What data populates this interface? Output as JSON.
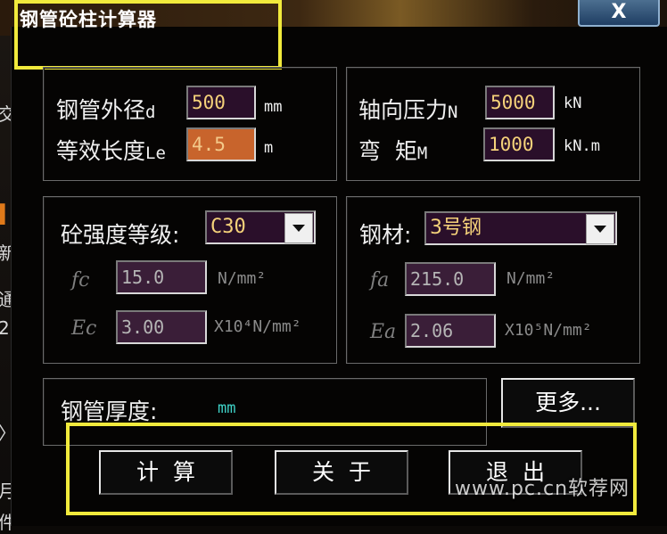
{
  "window": {
    "title": "钢管砼柱计算器",
    "close_label": "X"
  },
  "geometry": {
    "diameter": {
      "label": "钢管外径",
      "sub": "d",
      "value": "500",
      "unit": "mm"
    },
    "length": {
      "label": "等效长度",
      "sub": "Le",
      "value": "4.5",
      "unit": "m"
    }
  },
  "loads": {
    "axial": {
      "label": "轴向压力",
      "sub": "N",
      "value": "5000",
      "unit": "kN"
    },
    "moment": {
      "label": "弯  矩",
      "sub": "M",
      "value": "1000",
      "unit": "kN.m"
    }
  },
  "concrete": {
    "grade_label": "砼强度等级:",
    "grade_value": "C30",
    "fc": {
      "label": "fc",
      "value": "15.0",
      "unit": "N/mm²"
    },
    "ec": {
      "label": "Ec",
      "value": "3.00",
      "unit": "X10⁴N/mm²"
    }
  },
  "steel": {
    "label": "钢材:",
    "value": "3号钢",
    "fa": {
      "label": "fa",
      "value": "215.0",
      "unit": "N/mm²"
    },
    "ea": {
      "label": "Ea",
      "value": "2.06",
      "unit": "X10⁵N/mm²"
    }
  },
  "thickness": {
    "label": "钢管厚度:",
    "unit": "mm"
  },
  "buttons": {
    "more": "更多...",
    "calculate": "计  算",
    "about": "关  于",
    "exit": "退  出"
  },
  "watermark": "www.pc.cn软荐网",
  "colors": {
    "highlight": "#f1ea3c",
    "input_bg": "#2a0f2a",
    "input_text": "#f5d27a",
    "active_input_bg": "#c8642c",
    "thickness_unit": "#3fd3c8"
  }
}
